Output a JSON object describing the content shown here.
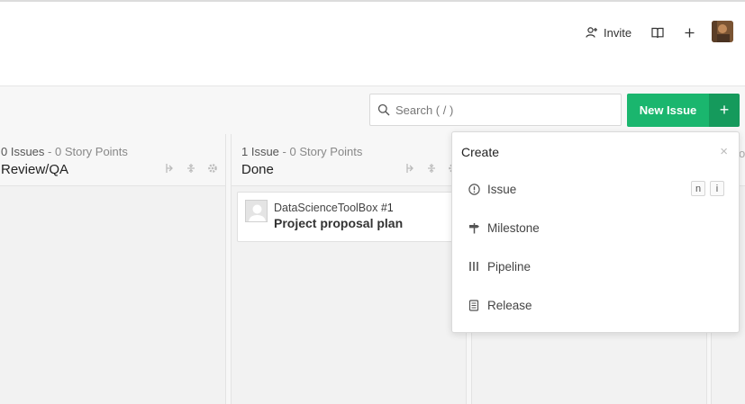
{
  "header": {
    "invite_label": "Invite",
    "icons": [
      "add-user-icon",
      "book-icon",
      "plus-icon"
    ]
  },
  "toolbar": {
    "search_placeholder": "Search ( / )",
    "new_issue_label": "New Issue",
    "plus_label": "+"
  },
  "columns": [
    {
      "count": "0 Issues",
      "points": " - 0 Story Points",
      "title": "Review/QA"
    },
    {
      "count": "1 Issue",
      "points": " - 0 Story Points",
      "title": "Done"
    }
  ],
  "card": {
    "repo": "DataScienceToolBox",
    "number": "#1",
    "title": "Project proposal plan"
  },
  "create_menu": {
    "heading": "Create",
    "close": "×",
    "items": [
      {
        "label": "Issue",
        "icon": "issue-icon",
        "shortcut": [
          "n",
          "i"
        ]
      },
      {
        "label": "Milestone",
        "icon": "milestone-icon"
      },
      {
        "label": "Pipeline",
        "icon": "pipeline-icon"
      },
      {
        "label": "Release",
        "icon": "release-icon"
      }
    ]
  },
  "peek_label": "o"
}
